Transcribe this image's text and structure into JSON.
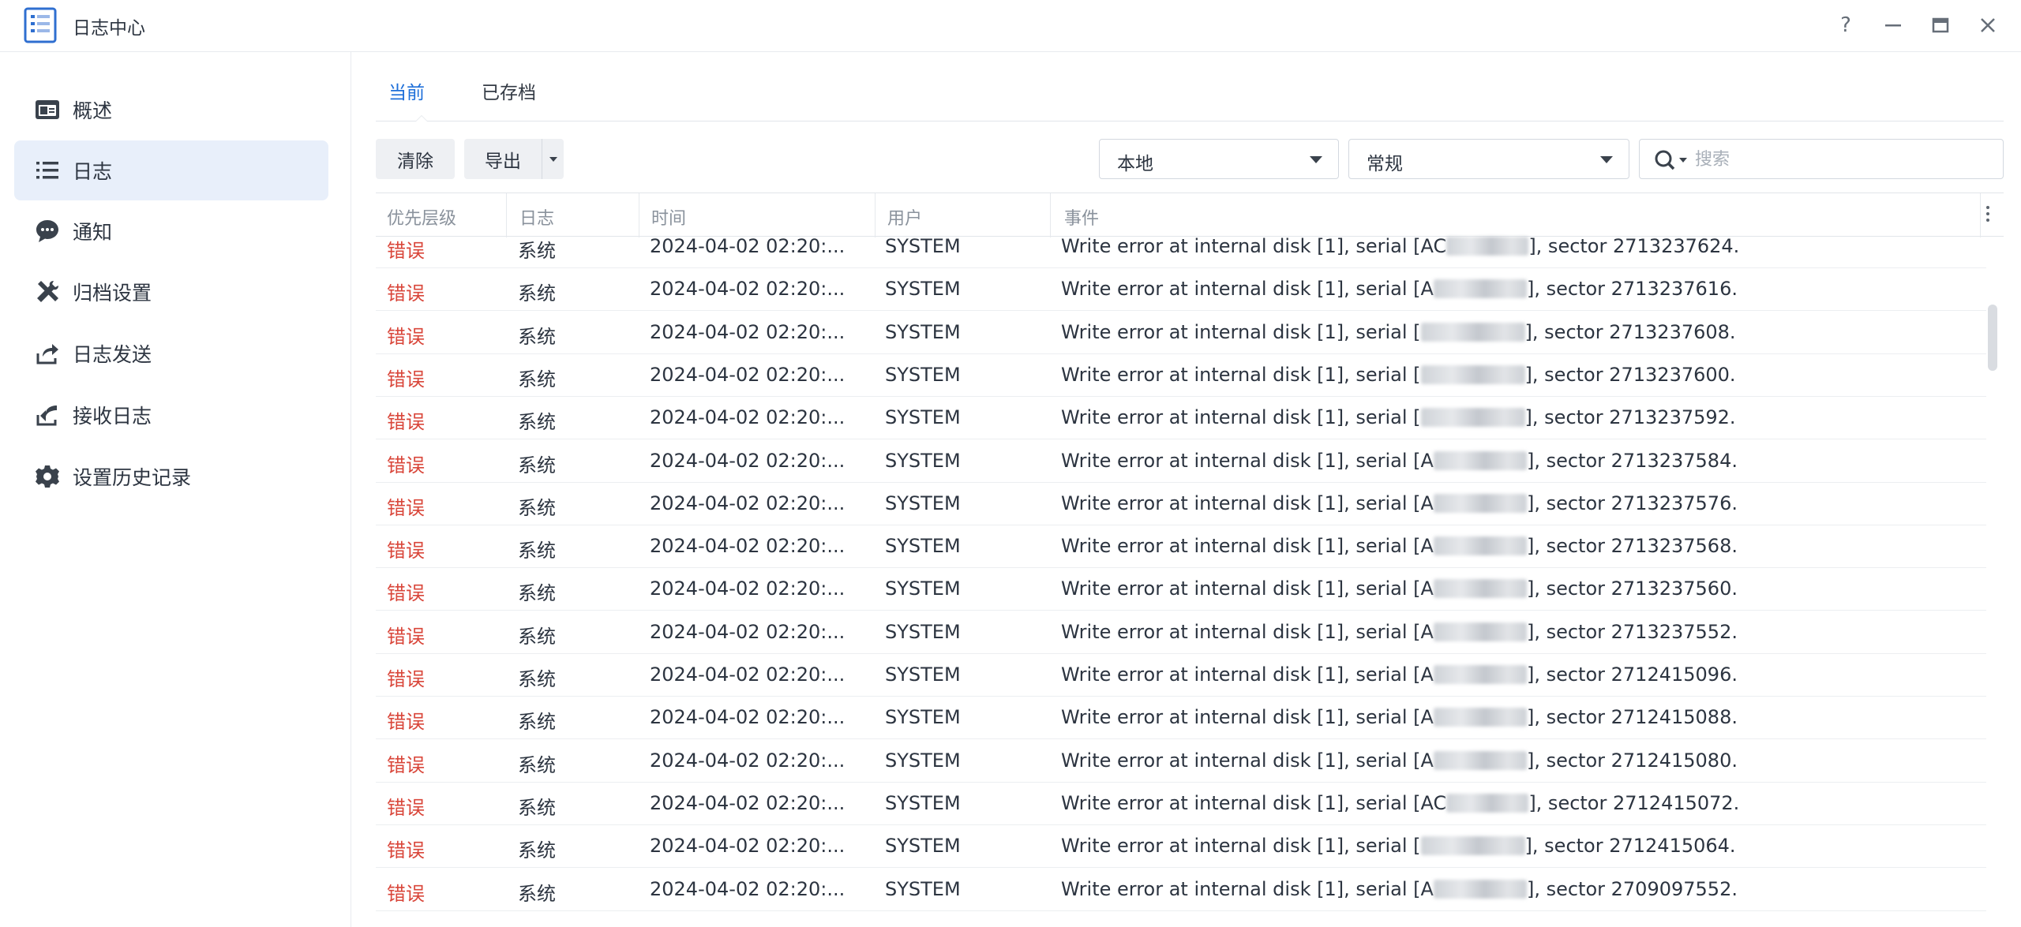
{
  "window": {
    "title": "日志中心",
    "controls": {
      "help": "?",
      "minimize": "—",
      "maximize": "▭",
      "close": "✕"
    }
  },
  "sidebar": {
    "items": [
      {
        "label": "概述",
        "icon": "overview-icon",
        "active": false
      },
      {
        "label": "日志",
        "icon": "list-icon",
        "active": true
      },
      {
        "label": "通知",
        "icon": "chat-bubble-icon",
        "active": false
      },
      {
        "label": "归档设置",
        "icon": "tools-icon",
        "active": false
      },
      {
        "label": "日志发送",
        "icon": "upload-icon",
        "active": false
      },
      {
        "label": "接收日志",
        "icon": "receive-icon",
        "active": false
      },
      {
        "label": "设置历史记录",
        "icon": "gear-icon",
        "active": false
      }
    ]
  },
  "tabs": [
    {
      "label": "当前",
      "active": true
    },
    {
      "label": "已存档",
      "active": false
    }
  ],
  "toolbar": {
    "clear_label": "清除",
    "export_label": "导出",
    "source_select": "本地",
    "type_select": "常规",
    "search_placeholder": "搜索"
  },
  "table": {
    "columns": [
      "优先层级",
      "日志",
      "时间",
      "用户",
      "事件"
    ],
    "rows": [
      {
        "level": "错误",
        "log": "系统",
        "time": "2024-04-02 02:20:...",
        "user": "SYSTEM",
        "event_prefix": "Write error at internal disk [1], serial [",
        "serial_visible": "AC",
        "event_suffix": "], sector 2713237624."
      },
      {
        "level": "错误",
        "log": "系统",
        "time": "2024-04-02 02:20:...",
        "user": "SYSTEM",
        "event_prefix": "Write error at internal disk [1], serial [",
        "serial_visible": "A",
        "event_suffix": "], sector 2713237616."
      },
      {
        "level": "错误",
        "log": "系统",
        "time": "2024-04-02 02:20:...",
        "user": "SYSTEM",
        "event_prefix": "Write error at internal disk [1], serial [",
        "serial_visible": "",
        "event_suffix": "], sector 2713237608."
      },
      {
        "level": "错误",
        "log": "系统",
        "time": "2024-04-02 02:20:...",
        "user": "SYSTEM",
        "event_prefix": "Write error at internal disk [1], serial [",
        "serial_visible": "",
        "event_suffix": "], sector 2713237600."
      },
      {
        "level": "错误",
        "log": "系统",
        "time": "2024-04-02 02:20:...",
        "user": "SYSTEM",
        "event_prefix": "Write error at internal disk [1], serial [",
        "serial_visible": "",
        "event_suffix": "], sector 2713237592."
      },
      {
        "level": "错误",
        "log": "系统",
        "time": "2024-04-02 02:20:...",
        "user": "SYSTEM",
        "event_prefix": "Write error at internal disk [1], serial [",
        "serial_visible": "A",
        "event_suffix": "], sector 2713237584."
      },
      {
        "level": "错误",
        "log": "系统",
        "time": "2024-04-02 02:20:...",
        "user": "SYSTEM",
        "event_prefix": "Write error at internal disk [1], serial [",
        "serial_visible": "A",
        "event_suffix": "], sector 2713237576."
      },
      {
        "level": "错误",
        "log": "系统",
        "time": "2024-04-02 02:20:...",
        "user": "SYSTEM",
        "event_prefix": "Write error at internal disk [1], serial [",
        "serial_visible": "A",
        "event_suffix": "], sector 2713237568."
      },
      {
        "level": "错误",
        "log": "系统",
        "time": "2024-04-02 02:20:...",
        "user": "SYSTEM",
        "event_prefix": "Write error at internal disk [1], serial [",
        "serial_visible": "A",
        "event_suffix": "], sector 2713237560."
      },
      {
        "level": "错误",
        "log": "系统",
        "time": "2024-04-02 02:20:...",
        "user": "SYSTEM",
        "event_prefix": "Write error at internal disk [1], serial [",
        "serial_visible": "A",
        "event_suffix": "], sector 2713237552."
      },
      {
        "level": "错误",
        "log": "系统",
        "time": "2024-04-02 02:20:...",
        "user": "SYSTEM",
        "event_prefix": "Write error at internal disk [1], serial [",
        "serial_visible": "A",
        "event_suffix": "], sector 2712415096."
      },
      {
        "level": "错误",
        "log": "系统",
        "time": "2024-04-02 02:20:...",
        "user": "SYSTEM",
        "event_prefix": "Write error at internal disk [1], serial [",
        "serial_visible": "A",
        "event_suffix": "], sector 2712415088."
      },
      {
        "level": "错误",
        "log": "系统",
        "time": "2024-04-02 02:20:...",
        "user": "SYSTEM",
        "event_prefix": "Write error at internal disk [1], serial [",
        "serial_visible": "A",
        "event_suffix": "], sector 2712415080."
      },
      {
        "level": "错误",
        "log": "系统",
        "time": "2024-04-02 02:20:...",
        "user": "SYSTEM",
        "event_prefix": "Write error at internal disk [1], serial [",
        "serial_visible": "AC",
        "event_suffix": "], sector 2712415072."
      },
      {
        "level": "错误",
        "log": "系统",
        "time": "2024-04-02 02:20:...",
        "user": "SYSTEM",
        "event_prefix": "Write error at internal disk [1], serial [",
        "serial_visible": "",
        "event_suffix": "], sector 2712415064."
      },
      {
        "level": "错误",
        "log": "系统",
        "time": "2024-04-02 02:20:...",
        "user": "SYSTEM",
        "event_prefix": "Write error at internal disk [1], serial [",
        "serial_visible": "A",
        "event_suffix": "], sector 2709097552."
      }
    ]
  },
  "colors": {
    "accent": "#1e6fd9",
    "error": "#d9463a",
    "sidebar_active_bg": "#e8effa"
  }
}
